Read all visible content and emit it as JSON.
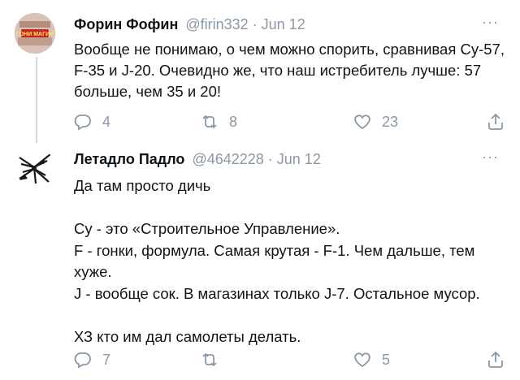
{
  "tweets": [
    {
      "author_name": "Форин Фофин",
      "handle_date": "@firin332 · Jun 12",
      "text": "Вообще не понимаю, о чем можно спорить, сравнивая Су-57, F-35 и J-20. Очевидно же, что наш истребитель лучше: 57 больше, чем 35 и 20!",
      "avatar_text": "ГОНИ МАГИИ",
      "more_label": "···",
      "reply_count": "4",
      "retweet_count": "8",
      "like_count": "23"
    },
    {
      "author_name": "Летадло Падло",
      "handle_date": "@4642228 · Jun 12",
      "text": "Да там просто дичь\n\nСу - это «Строительное Управление».\nF - гонки, формула. Самая крутая - F-1. Чем дальше, тем хуже.\nJ - вообще сок. В магазинах только J-7. Остальное мусор.\n\nХЗ кто им дал самолеты делать.",
      "more_label": "···",
      "reply_count": "7",
      "retweet_count": "",
      "like_count": "5"
    }
  ],
  "icons": [
    "reply-icon",
    "retweet-icon",
    "like-icon",
    "share-icon",
    "more-icon"
  ],
  "colors": {
    "text": "#0f1419",
    "muted": "#8b98a5",
    "thread_line": "#cfd9de"
  }
}
